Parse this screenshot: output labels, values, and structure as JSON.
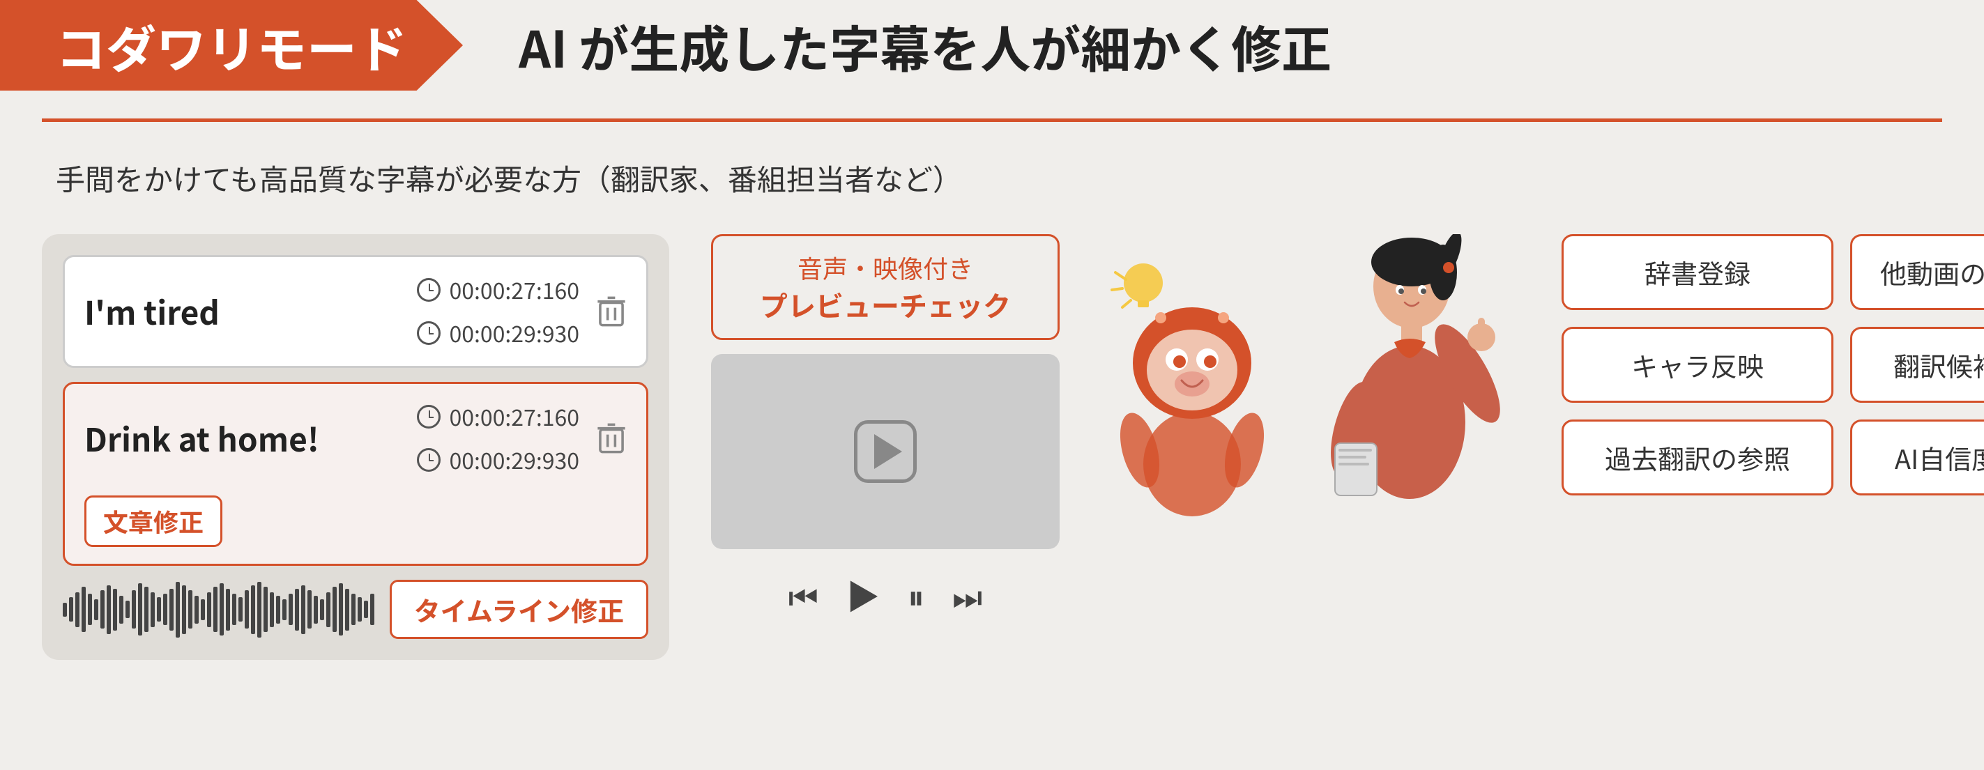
{
  "header": {
    "badge_text": "コダワリモード",
    "title_text": "AI が生成した字幕を人が細かく修正"
  },
  "subtitle_line": "手間をかけても高品質な字幕が必要な方（翻訳家、番組担当者など）",
  "editor": {
    "row1": {
      "text": "I'm tired",
      "time1": "00:00:27:160",
      "time2": "00:00:29:930"
    },
    "row2": {
      "text": "Drink at home!",
      "time1": "00:00:27:160",
      "time2": "00:00:29:930",
      "correction_label": "文章修正"
    },
    "timeline_label": "タイムライン修正"
  },
  "preview": {
    "label_top": "音声・映像付き",
    "label_bottom": "プレビューチェック"
  },
  "features": [
    "辞書登録",
    "他動画の追加学習",
    "キャラ反映",
    "翻訳候補の選択",
    "過去翻訳の参照",
    "AI自信度の表示"
  ],
  "colors": {
    "accent": "#d4512a",
    "bg": "#f0eeeb",
    "panel_bg": "#e0ddd8"
  }
}
